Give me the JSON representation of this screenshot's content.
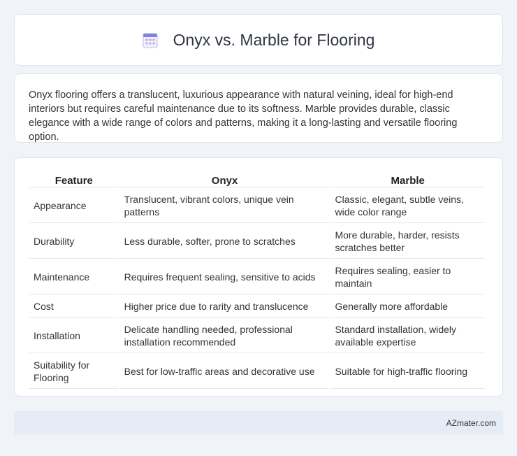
{
  "header": {
    "title": "Onyx vs. Marble for Flooring",
    "icon": "calendar-icon"
  },
  "intro": {
    "text": "Onyx flooring offers a translucent, luxurious appearance with natural veining, ideal for high-end interiors but requires careful maintenance due to its softness. Marble provides durable, classic elegance with a wide range of colors and patterns, making it a long-lasting and versatile flooring option."
  },
  "table": {
    "headers": [
      "Feature",
      "Onyx",
      "Marble"
    ],
    "rows": [
      [
        "Appearance",
        "Translucent, vibrant colors, unique vein patterns",
        "Classic, elegant, subtle veins, wide color range"
      ],
      [
        "Durability",
        "Less durable, softer, prone to scratches",
        "More durable, harder, resists scratches better"
      ],
      [
        "Maintenance",
        "Requires frequent sealing, sensitive to acids",
        "Requires sealing, easier to maintain"
      ],
      [
        "Cost",
        "Higher price due to rarity and translucence",
        "Generally more affordable"
      ],
      [
        "Installation",
        "Delicate handling needed, professional installation recommended",
        "Standard installation, widely available expertise"
      ],
      [
        "Suitability for Flooring",
        "Best for low-traffic areas and decorative use",
        "Suitable for high-traffic flooring"
      ]
    ]
  },
  "footer": {
    "text": "AZmater.com"
  }
}
